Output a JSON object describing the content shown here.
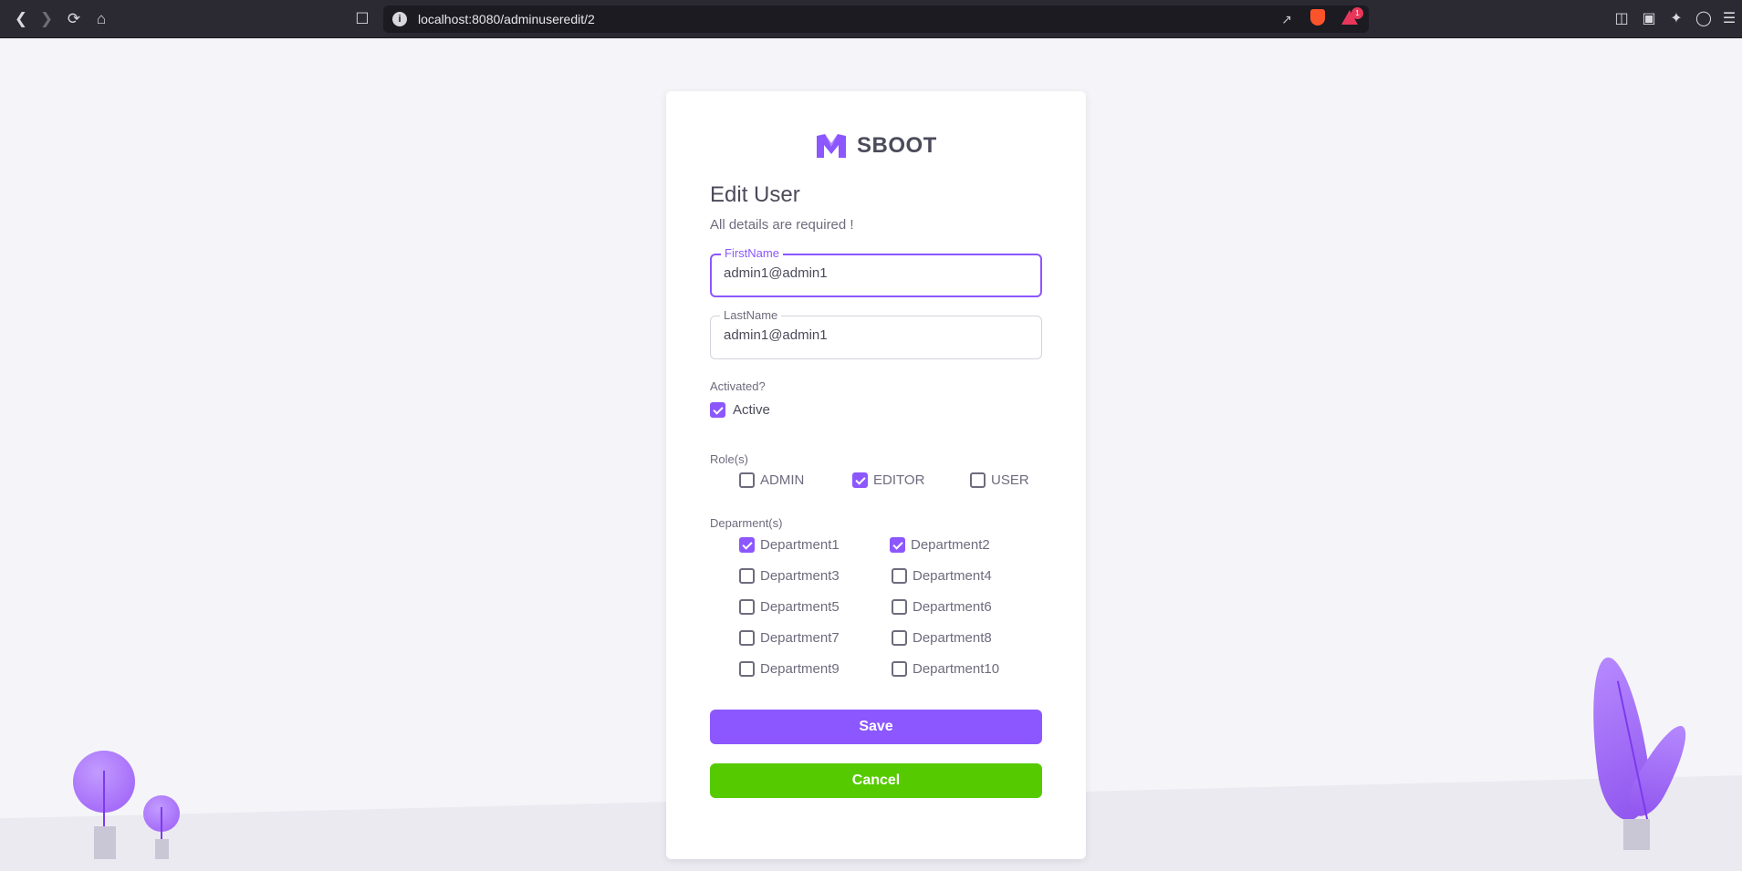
{
  "browser": {
    "url": "localhost:8080/adminuseredit/2",
    "alert_count": "1"
  },
  "brand": {
    "name": "SBOOT",
    "color": "#8c57ff"
  },
  "form": {
    "title": "Edit User",
    "subtitle": "All details are required !",
    "first_name": {
      "label": "FirstName",
      "value": "admin1@admin1"
    },
    "last_name": {
      "label": "LastName",
      "value": "admin1@admin1"
    },
    "activated": {
      "label": "Activated?",
      "option": "Active",
      "checked": true
    },
    "roles": {
      "label": "Role(s)",
      "options": [
        {
          "label": "ADMIN",
          "checked": false
        },
        {
          "label": "EDITOR",
          "checked": true
        },
        {
          "label": "USER",
          "checked": false
        }
      ]
    },
    "departments": {
      "label": "Deparment(s)",
      "options": [
        {
          "label": "Department1",
          "checked": true
        },
        {
          "label": "Department2",
          "checked": true
        },
        {
          "label": "Department3",
          "checked": false
        },
        {
          "label": "Department4",
          "checked": false
        },
        {
          "label": "Department5",
          "checked": false
        },
        {
          "label": "Department6",
          "checked": false
        },
        {
          "label": "Department7",
          "checked": false
        },
        {
          "label": "Department8",
          "checked": false
        },
        {
          "label": "Department9",
          "checked": false
        },
        {
          "label": "Department10",
          "checked": false
        }
      ]
    },
    "save_label": "Save",
    "cancel_label": "Cancel"
  },
  "colors": {
    "primary": "#8c57ff",
    "success": "#56ca00"
  }
}
